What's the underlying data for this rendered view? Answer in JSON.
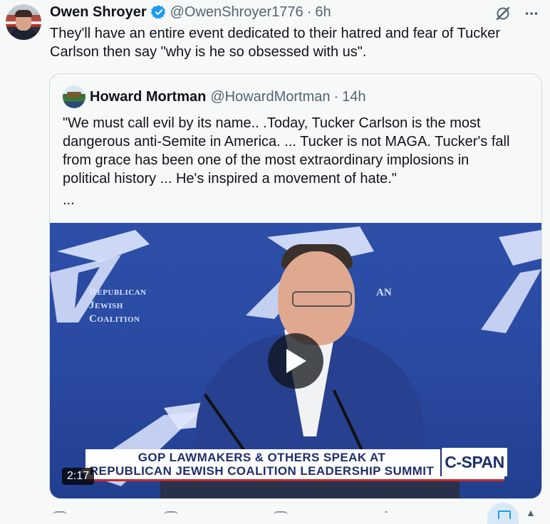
{
  "tweet": {
    "author_name": "Owen Shroyer",
    "handle": "@OwenShroyer1776",
    "separator": "·",
    "time": "6h",
    "text": "They'll have an entire event dedicated to their hatred and fear of Tucker\nCarlson then say \"why is he so obsessed with us\".",
    "icons": [
      "verified-badge-icon",
      "grok-icon",
      "more-options-icon"
    ]
  },
  "quoted": {
    "author_name": "Howard Mortman",
    "handle": "@HowardMortman",
    "separator": "·",
    "time": "14h",
    "text": "\"We must call evil by its name.. .Today, Tucker Carlson is the most\ndangerous anti-Semite in America. ... Tucker is not MAGA. Tucker's fall\nfrom grace has been one of the most extraordinary implosions in\npolitical history ... He's inspired a movement of hate.\"",
    "more": "...",
    "video": {
      "backdrop_line1": "Republican",
      "backdrop_line2": "Jewish",
      "backdrop_line3": "Coalition",
      "backdrop_partial": "AN",
      "chyron_line1": "GOP LAWMAKERS & OTHERS SPEAK AT",
      "chyron_line2": "REPUBLICAN JEWISH COALITION LEADERSHIP SUMMIT",
      "network": "C-SPAN",
      "duration": "2:17"
    }
  },
  "actions": {
    "icons": [
      "reply-icon",
      "repost-icon",
      "like-icon",
      "views-icon",
      "bookmark-icon",
      "share-icon"
    ]
  },
  "colors": {
    "accent": "#1d9bf0",
    "text": "#0f1419",
    "secondary": "#536471",
    "background": "#f7f9f9",
    "border": "#cfd9de",
    "video_blue": "#2a4aa2"
  }
}
